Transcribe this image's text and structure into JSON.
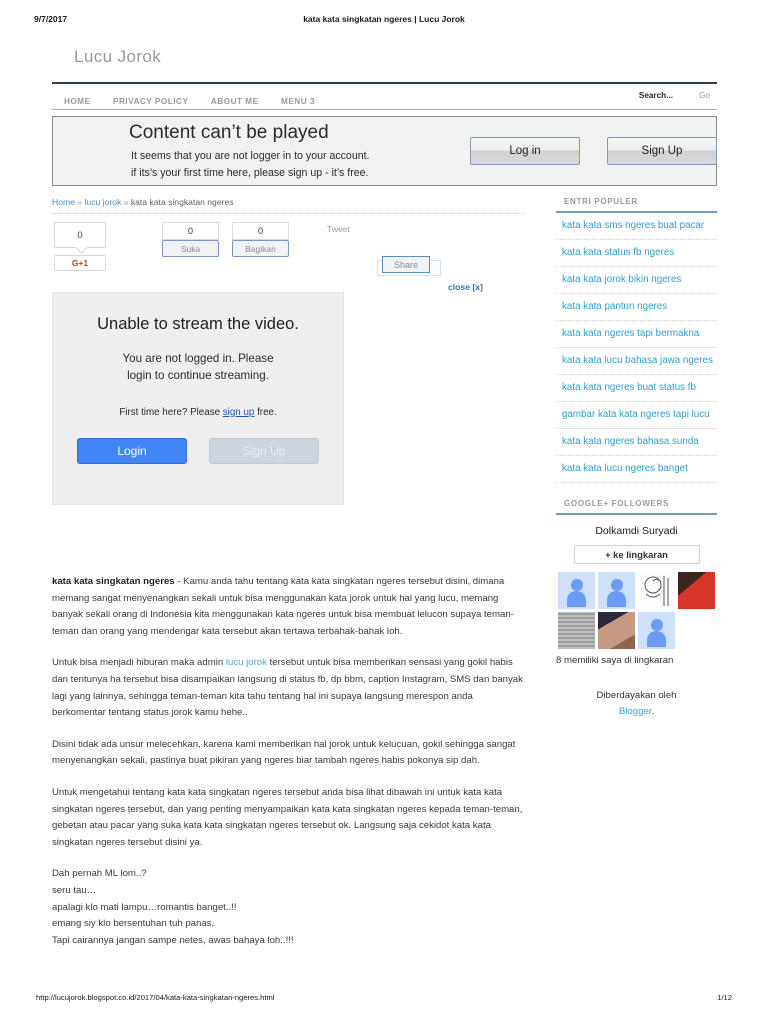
{
  "print": {
    "date": "9/7/2017",
    "doc_title": "kata kata singkatan ngeres | Lucu Jorok",
    "url": "http://lucujorok.blogspot.co.id/2017/04/kata-kata-singkatan-ngeres.html",
    "page": "1/12"
  },
  "header": {
    "blog_title": "Lucu Jorok"
  },
  "nav": {
    "items": [
      {
        "label": "HOME"
      },
      {
        "label": "PRIVACY POLICY"
      },
      {
        "label": "ABOUT ME"
      },
      {
        "label": "MENU 3"
      }
    ],
    "search_placeholder": "Search...",
    "go_label": "Go"
  },
  "notice": {
    "heading": "Content can’t be played",
    "line1": "It seems that you are not logger in to your account.",
    "line2": "if its’s your first time here, please sign up -  it’s free.",
    "login_label": "Log in",
    "signup_label": "Sign Up"
  },
  "breadcrumb": {
    "home": "Home",
    "sep": "»",
    "category": "lucu jorok",
    "current": "kata kata singkatan ngeres"
  },
  "share": {
    "gplus_count": "0",
    "gplus_label": "G+1",
    "like_count": "0",
    "like_label": "Suka",
    "fbshare_count": "0",
    "fbshare_label": "Bagikan",
    "tweet_label": "Tweet",
    "pin_label": "Share"
  },
  "modal": {
    "close_label": "close [x]",
    "heading": "Unable to stream the video.",
    "sub_line1": "You are not logged in. Please",
    "sub_line2": "login to continue streaming.",
    "note_prefix": "First time here? Please ",
    "note_link": "sign up",
    "note_suffix": " free.",
    "login_label": "Login",
    "signup_label": "Sign Up"
  },
  "article": {
    "p1_bold": "kata kata singkatan ngeres",
    "p1_rest": " - Kamu anda tahu tentang kata kata singkatan ngeres tersebut disini, dimana memang sangat menyenangkan sekali untuk bisa menggunakan kata jorok untuk hal yang lucu, memang banyak sekali orang di Indonesia kita menggunakan kata ngeres untuk bisa membuat lelucon supaya teman-teman dan orang yang mendengar kata tersebut akan tertawa terbahak-bahak loh.",
    "p2_a": "Untuk bisa menjadi hiburan maka admin ",
    "p2_link": "lucu jorok",
    "p2_b": " tersebut untuk bisa memberikan sensasi yang gokil habis dan tentunya ha tersebut bisa disampaikan langsung di status fb, dp bbm, caption Instagram, SMS dan banyak lagi yang lainnya, sehingga teman-teman kita tahu tentang hal ini supaya langsung merespon anda berkomentar tentang status jorok kamu hehe..",
    "p3": "Disini tidak ada unsur melecehkan, karena kami memberikan hal jorok untuk kelucuan, gokil sehingga sangat menyenangkan sekali, pastinya buat pikiran yang ngeres biar tambah ngeres habis pokonya sip dah.",
    "p4": "Untuk mengetahui tentang kata kata singkatan ngeres tersebut anda bisa lihat dibawah ini untuk kata kata singkatan ngeres tersebut, dan yang penting menyampaikan kata kata singkatan ngeres kepada teman-teman, gebetan atau pacar yang suka kata kata singkatan ngeres tersebut ok. Langsung saja cekidot kata kata singkatan ngeres tersebut disini ya.",
    "poem": [
      "Dah pernah ML lom..?",
      "seru tau…",
      "apalagi klo mati lampu…romantis banget..!!",
      "emang siy klo bersentuhan tuh panas,",
      "Tapi cairannya jangan sampe netes, awas bahaya loh..!!!"
    ]
  },
  "sidebar": {
    "popular": {
      "title": "ENTRI POPULER",
      "items": [
        {
          "label": "kata kata sms ngeres buat pacar"
        },
        {
          "label": "kata kata status fb ngeres"
        },
        {
          "label": "kata kata jorok bikin ngeres"
        },
        {
          "label": "kata kata pantun ngeres"
        },
        {
          "label": "kata kata ngeres tapi bermakna"
        },
        {
          "label": "kata kata lucu bahasa jawa ngeres"
        },
        {
          "label": "kata kata ngeres buat status fb"
        },
        {
          "label": "gambar kata kata ngeres tapi lucu"
        },
        {
          "label": "kata kata ngeres bahasa sunda"
        },
        {
          "label": "kata kata lucu ngeres banget"
        }
      ]
    },
    "followers": {
      "title": "GOOGLE+ FOLLOWERS",
      "owner": "Dolkamdi Suryadi",
      "add_label": "+ ke lingkaran",
      "count_label": "8 memiliki saya di lingkaran"
    },
    "powered": {
      "prefix": "Diberdayakan oleh",
      "link": "Blogger",
      "suffix": "."
    }
  },
  "colors": {
    "link": "#2f9fd0",
    "nav_rule": "#2c3e50",
    "accent": "#6f9dc0",
    "primary_button": "#4285f4"
  }
}
